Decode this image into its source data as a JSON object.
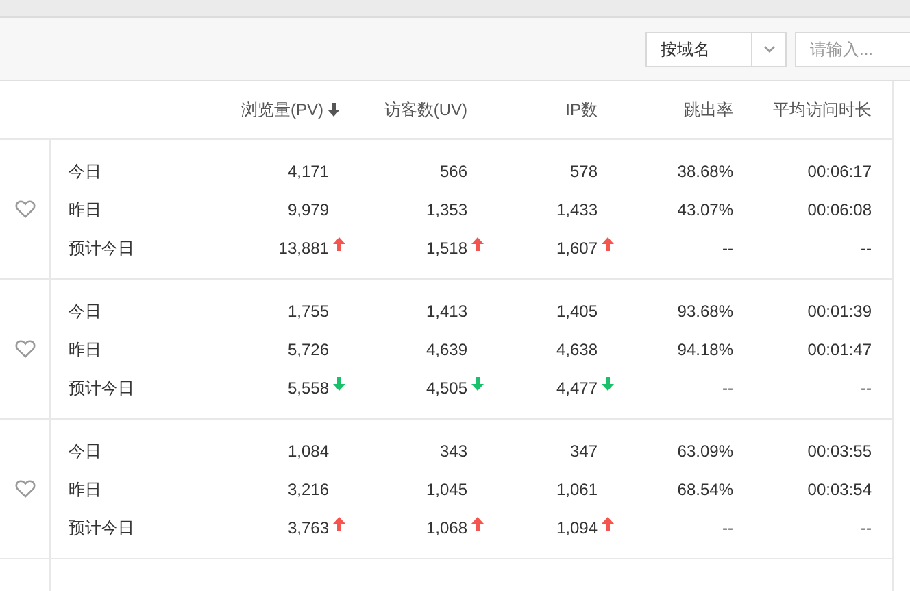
{
  "toolbar": {
    "select": {
      "value": "按域名"
    },
    "search": {
      "placeholder": "请输入..."
    }
  },
  "columns": [
    {
      "label": "浏览量(PV)",
      "sorted_desc": true
    },
    {
      "label": "访客数(UV)"
    },
    {
      "label": "IP数"
    },
    {
      "label": "跳出率"
    },
    {
      "label": "平均访问时长"
    }
  ],
  "groups": [
    {
      "favorite": false,
      "rows": [
        {
          "label": "今日",
          "cells": [
            {
              "text": "4,171"
            },
            {
              "text": "566"
            },
            {
              "text": "578"
            },
            {
              "text": "38.68%"
            },
            {
              "text": "00:06:17"
            }
          ]
        },
        {
          "label": "昨日",
          "cells": [
            {
              "text": "9,979"
            },
            {
              "text": "1,353"
            },
            {
              "text": "1,433"
            },
            {
              "text": "43.07%"
            },
            {
              "text": "00:06:08"
            }
          ]
        },
        {
          "label": "预计今日",
          "cells": [
            {
              "text": "13,881",
              "rising": true
            },
            {
              "text": "1,518",
              "rising": true
            },
            {
              "text": "1,607",
              "rising": true
            },
            {
              "text": "--"
            },
            {
              "text": "--"
            }
          ]
        }
      ]
    },
    {
      "favorite": false,
      "rows": [
        {
          "label": "今日",
          "cells": [
            {
              "text": "1,755"
            },
            {
              "text": "1,413"
            },
            {
              "text": "1,405"
            },
            {
              "text": "93.68%"
            },
            {
              "text": "00:01:39"
            }
          ]
        },
        {
          "label": "昨日",
          "cells": [
            {
              "text": "5,726"
            },
            {
              "text": "4,639"
            },
            {
              "text": "4,638"
            },
            {
              "text": "94.18%"
            },
            {
              "text": "00:01:47"
            }
          ]
        },
        {
          "label": "预计今日",
          "cells": [
            {
              "text": "5,558",
              "rising": false
            },
            {
              "text": "4,505",
              "rising": false
            },
            {
              "text": "4,477",
              "rising": false
            },
            {
              "text": "--"
            },
            {
              "text": "--"
            }
          ]
        }
      ]
    },
    {
      "favorite": false,
      "rows": [
        {
          "label": "今日",
          "cells": [
            {
              "text": "1,084"
            },
            {
              "text": "343"
            },
            {
              "text": "347"
            },
            {
              "text": "63.09%"
            },
            {
              "text": "00:03:55"
            }
          ]
        },
        {
          "label": "昨日",
          "cells": [
            {
              "text": "3,216"
            },
            {
              "text": "1,045"
            },
            {
              "text": "1,061"
            },
            {
              "text": "68.54%"
            },
            {
              "text": "00:03:54"
            }
          ]
        },
        {
          "label": "预计今日",
          "cells": [
            {
              "text": "3,763",
              "rising": true
            },
            {
              "text": "1,068",
              "rising": true
            },
            {
              "text": "1,094",
              "rising": true
            },
            {
              "text": "--"
            },
            {
              "text": "--"
            }
          ]
        }
      ]
    }
  ]
}
